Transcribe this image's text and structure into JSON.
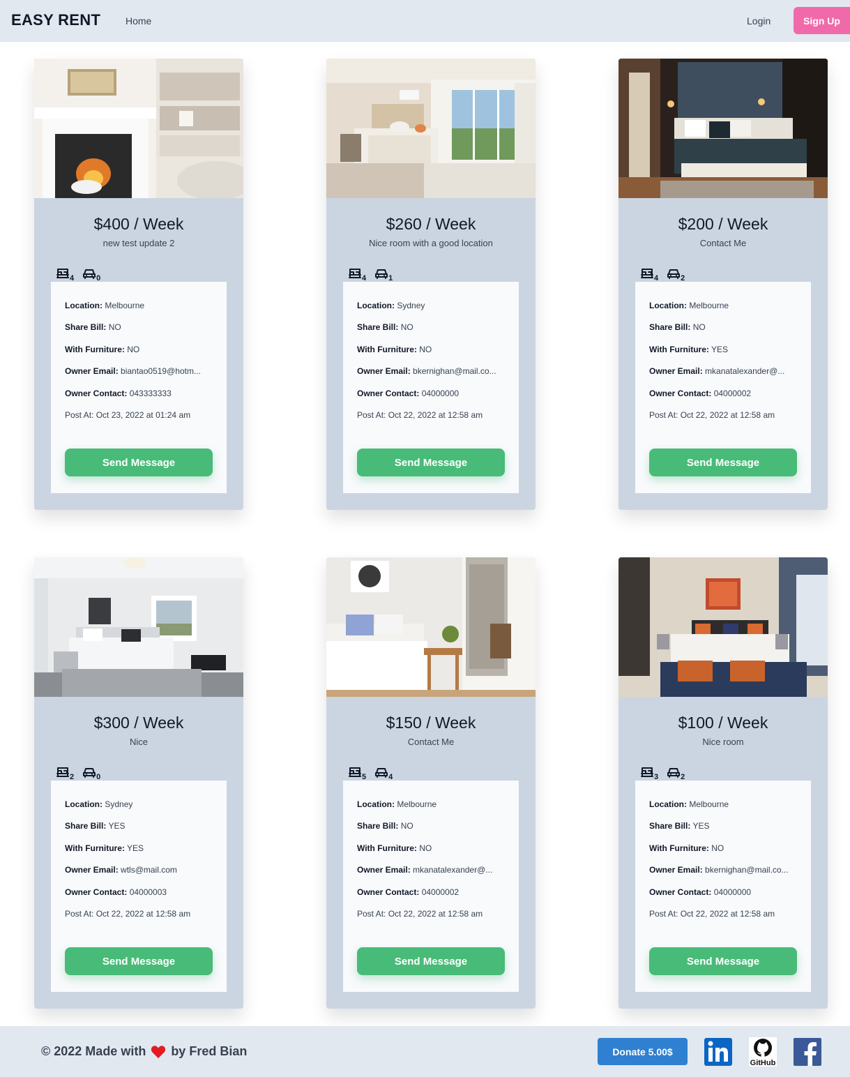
{
  "nav": {
    "brand": "EASY RENT",
    "home": "Home",
    "login": "Login",
    "signup": "Sign Up"
  },
  "labels": {
    "location": "Location:",
    "share_bill": "Share Bill:",
    "furniture": "With Furniture:",
    "owner_email": "Owner Email:",
    "owner_contact": "Owner Contact:",
    "send_message": "Send Message"
  },
  "listings": [
    {
      "price": "$400 / Week",
      "description": "new test update 2",
      "bedrooms": "4",
      "parking": "0",
      "location": "Melbourne",
      "share_bill": "NO",
      "furniture": "NO",
      "owner_email": "biantao0519@hotm...",
      "owner_contact": "043333333",
      "posted": "Post At: Oct 23, 2022 at 01:24 am"
    },
    {
      "price": "$260 / Week",
      "description": "Nice room with a good location",
      "bedrooms": "4",
      "parking": "1",
      "location": "Sydney",
      "share_bill": "NO",
      "furniture": "NO",
      "owner_email": "bkernighan@mail.co...",
      "owner_contact": "04000000",
      "posted": "Post At: Oct 22, 2022 at 12:58 am"
    },
    {
      "price": "$200 / Week",
      "description": "Contact Me",
      "bedrooms": "4",
      "parking": "2",
      "location": "Melbourne",
      "share_bill": "NO",
      "furniture": "YES",
      "owner_email": "mkanatalexander@...",
      "owner_contact": "04000002",
      "posted": "Post At: Oct 22, 2022 at 12:58 am"
    },
    {
      "price": "$300 / Week",
      "description": "Nice",
      "bedrooms": "2",
      "parking": "0",
      "location": "Sydney",
      "share_bill": "YES",
      "furniture": "YES",
      "owner_email": "wtls@mail.com",
      "owner_contact": "04000003",
      "posted": "Post At: Oct 22, 2022 at 12:58 am"
    },
    {
      "price": "$150 / Week",
      "description": "Contact Me",
      "bedrooms": "5",
      "parking": "4",
      "location": "Melbourne",
      "share_bill": "NO",
      "furniture": "NO",
      "owner_email": "mkanatalexander@...",
      "owner_contact": "04000002",
      "posted": "Post At: Oct 22, 2022 at 12:58 am"
    },
    {
      "price": "$100 / Week",
      "description": "Nice room",
      "bedrooms": "3",
      "parking": "2",
      "location": "Melbourne",
      "share_bill": "YES",
      "furniture": "NO",
      "owner_email": "bkernighan@mail.co...",
      "owner_contact": "04000000",
      "posted": "Post At: Oct 22, 2022 at 12:58 am"
    }
  ],
  "footer": {
    "copyright_prefix": "© 2022 Made with",
    "copyright_suffix": "by Fred Bian",
    "donate": "Donate 5.00$",
    "github_label": "GitHub"
  },
  "colors": {
    "nav_bg": "#e2e8f0",
    "card_bg": "#cbd5e1",
    "signup": "#f06aa9",
    "send_button": "#48bb78",
    "donate": "#2f80d1"
  }
}
